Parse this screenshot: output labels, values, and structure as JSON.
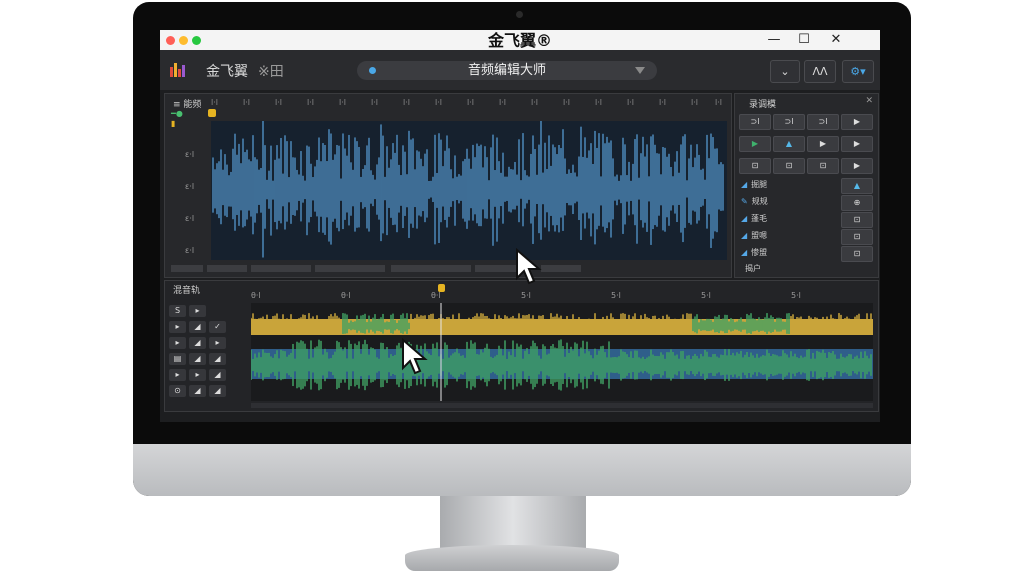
{
  "window": {
    "title": "金飞翼®",
    "controls": {
      "minimize": "—",
      "maximize": "☐",
      "close": "✕"
    },
    "traffic_colors": [
      "#ff5f57",
      "#febc2e",
      "#28c840"
    ]
  },
  "toolbar": {
    "brand": "金飞翼",
    "brand_extra": "※田",
    "search_text": "音频编辑大师",
    "view_button": "⌄",
    "au_button": "ΛΛ"
  },
  "editor": {
    "title": "≡ 能频",
    "ruler_labels": [
      "l·l",
      "l·l",
      "l·l",
      "l·l",
      "l·l",
      "l·l",
      "l·l",
      "l·l",
      "l·l",
      "l·l",
      "l·l",
      "l·l",
      "l·l",
      "l·l",
      "l·l",
      "l·l",
      "l·l"
    ],
    "amp_labels": [
      "ε·l",
      "ε·l",
      "ε·l",
      "ε·l",
      "ε·l"
    ],
    "wave_color": "#4f8fc2",
    "wave_bg": "#16212e"
  },
  "effects": {
    "title": "录调模",
    "close": "✕",
    "grid_buttons": [
      "⊃l",
      "⊃l",
      "⊃l",
      "▶",
      "▶",
      "▲",
      "▶",
      "▶",
      "⊡",
      "⊡",
      "⊡",
      "▶"
    ],
    "rows": [
      {
        "icon": "◢",
        "label": "掘腿",
        "btn": "▲"
      },
      {
        "icon": "✎",
        "label": "规规",
        "btn": "⊕"
      },
      {
        "icon": "◢",
        "label": "蓬毛",
        "btn": "⊡"
      },
      {
        "icon": "◢",
        "label": "盟嗯",
        "btn": "⊡"
      },
      {
        "icon": "◢",
        "label": "惨盟",
        "btn": "⊡"
      },
      {
        "icon": "",
        "label": "揭户",
        "btn": ""
      }
    ]
  },
  "tracks": {
    "title": "混音轨",
    "ruler_labels": [
      "θ·l",
      "θ·l",
      "θ·l",
      "5·l",
      "5·l",
      "5·l",
      "5·l"
    ],
    "colors": {
      "gold": "#c9a43b",
      "green": "#3fa063",
      "blue": "#2f5e8a"
    }
  }
}
